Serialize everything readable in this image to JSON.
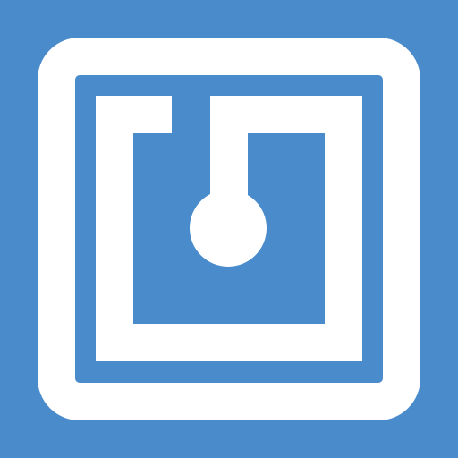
{
  "icon": {
    "name": "nfc-tag-icon",
    "background_color": "#4a8ccb",
    "foreground_color": "#ffffff"
  }
}
